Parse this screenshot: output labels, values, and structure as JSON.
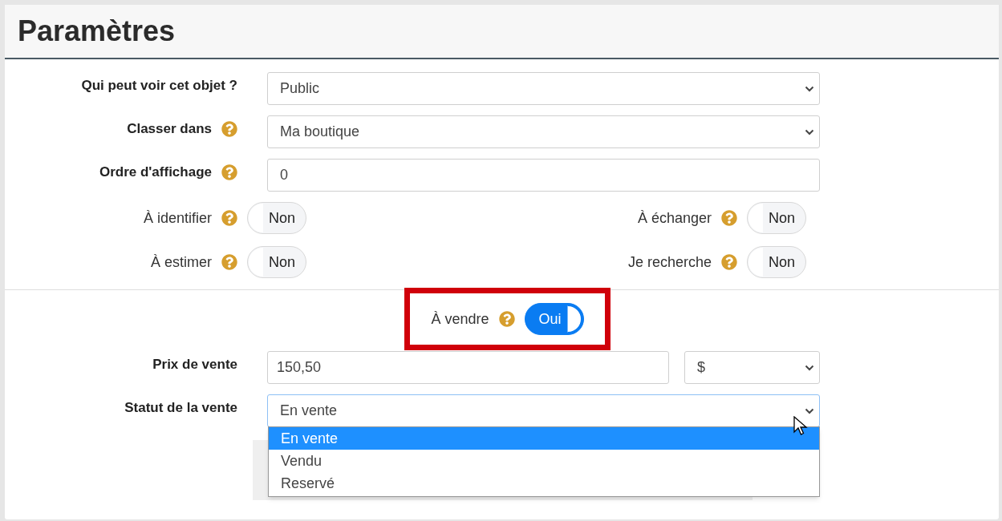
{
  "header": {
    "title": "Paramètres"
  },
  "fields": [
    {
      "kind": "select",
      "label": "Qui peut voir cet objet ?",
      "help": false,
      "value": "Public"
    },
    {
      "kind": "select",
      "label": "Classer dans",
      "help": true,
      "value": "Ma boutique"
    },
    {
      "kind": "input",
      "label": "Ordre d'affichage",
      "help": true,
      "value": "0"
    }
  ],
  "toggles": [
    {
      "label": "À identifier",
      "on": false,
      "text": "Non"
    },
    {
      "label": "À échanger",
      "on": false,
      "text": "Non"
    },
    {
      "label": "À estimer",
      "on": false,
      "text": "Non"
    },
    {
      "label": "Je recherche",
      "on": false,
      "text": "Non"
    }
  ],
  "sale_toggle": {
    "label": "À vendre",
    "on": true,
    "text": "Oui",
    "highlighted": true
  },
  "price": {
    "label": "Prix de vente",
    "value": "150,50",
    "currency": "$"
  },
  "status": {
    "label": "Statut de la vente",
    "value": "En vente",
    "expanded": true,
    "options": [
      {
        "label": "En vente",
        "selected": true
      },
      {
        "label": "Vendu",
        "selected": false
      },
      {
        "label": "Reservé",
        "selected": false
      }
    ]
  }
}
